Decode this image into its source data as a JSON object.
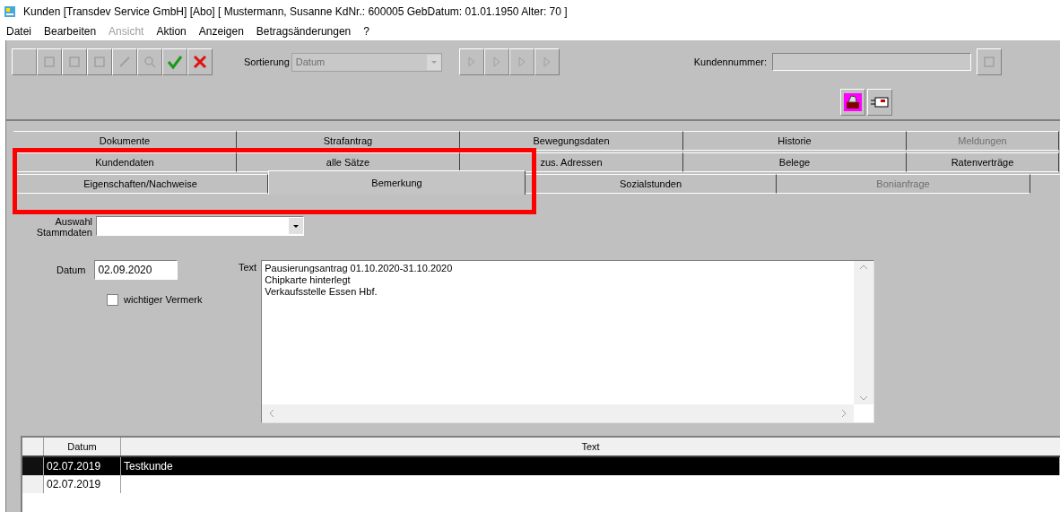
{
  "window": {
    "title": "Kunden [Transdev Service GmbH] [Abo] [ Mustermann, Susanne KdNr.: 600005 GebDatum: 01.01.1950 Alter: 70 ]"
  },
  "menu": [
    {
      "label": "Datei",
      "disabled": false
    },
    {
      "label": "Bearbeiten",
      "disabled": false
    },
    {
      "label": "Ansicht",
      "disabled": true
    },
    {
      "label": "Aktion",
      "disabled": false
    },
    {
      "label": "Anzeigen",
      "disabled": false
    },
    {
      "label": "Betragsänderungen",
      "disabled": false
    },
    {
      "label": "?",
      "disabled": false
    }
  ],
  "toolbar": {
    "sort_label": "Sortierung",
    "sort_value": "Datum",
    "customer_number_label": "Kundennummer:"
  },
  "tab_rows": [
    [
      {
        "label": "Dokumente",
        "selected": false,
        "disabled": false
      },
      {
        "label": "Strafantrag",
        "selected": false,
        "disabled": false
      },
      {
        "label": "Bewegungsdaten",
        "selected": false,
        "disabled": false
      },
      {
        "label": "Historie",
        "selected": false,
        "disabled": false
      },
      {
        "label": "Meldungen",
        "selected": false,
        "disabled": true
      }
    ],
    [
      {
        "label": "Kundendaten",
        "selected": false,
        "disabled": false
      },
      {
        "label": "alle Sätze",
        "selected": false,
        "disabled": false
      },
      {
        "label": "zus. Adressen",
        "selected": false,
        "disabled": false
      },
      {
        "label": "Belege",
        "selected": false,
        "disabled": false
      },
      {
        "label": "Ratenverträge",
        "selected": false,
        "disabled": false
      }
    ],
    [
      {
        "label": "Eigenschaften/Nachweise",
        "selected": false,
        "disabled": false
      },
      {
        "label": "Bemerkung",
        "selected": true,
        "disabled": false
      },
      {
        "label": "Sozialstunden",
        "selected": false,
        "disabled": false
      },
      {
        "label": "Bonianfrage",
        "selected": false,
        "disabled": true
      }
    ]
  ],
  "form": {
    "selection_label": "Auswahl Stammdaten",
    "date_label": "Datum",
    "date_value": "02.09.2020",
    "text_label": "Text",
    "text_lines": [
      "Pausierungsantrag 01.10.2020-31.10.2020",
      "Chipkarte hinterlegt",
      "Verkaufsstelle Essen Hbf."
    ],
    "important": {
      "label": "wichtiger Vermerk",
      "checked": false
    }
  },
  "grid": {
    "columns": [
      "Datum",
      "Text"
    ],
    "rows": [
      {
        "cells": [
          "02.07.2019",
          "Testkunde"
        ],
        "selected": true
      },
      {
        "cells": [
          "02.07.2019",
          ""
        ],
        "selected": false
      }
    ]
  }
}
